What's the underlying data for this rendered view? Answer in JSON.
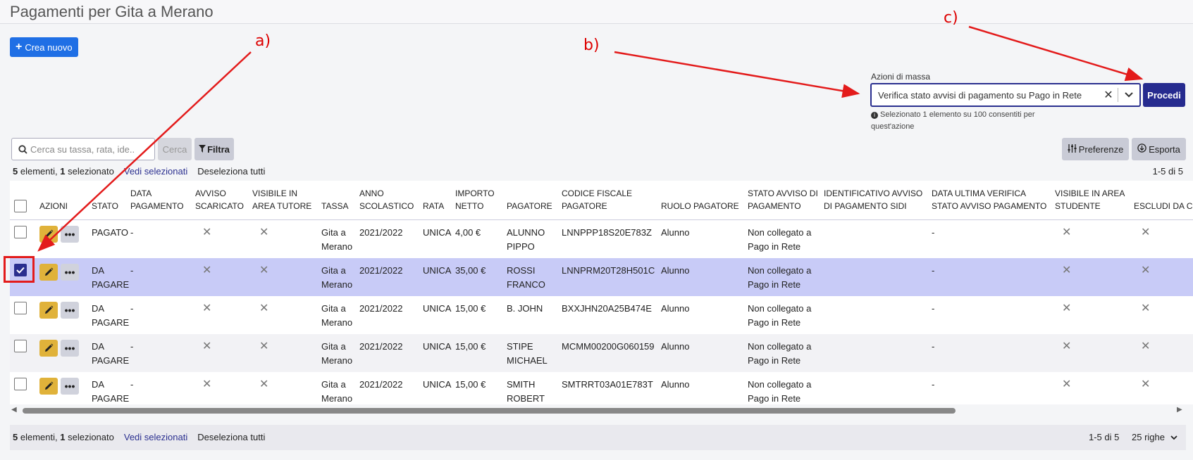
{
  "page": {
    "title": "Pagamenti per Gita a Merano"
  },
  "toolbar": {
    "create_label": "Crea nuovo",
    "search_placeholder": "Cerca su tassa, rata, ide..",
    "cerca_label": "Cerca",
    "filtra_label": "Filtra",
    "preferenze_label": "Preferenze",
    "esporta_label": "Esporta"
  },
  "mass_actions": {
    "label": "Azioni di massa",
    "selected_value": "Verifica stato avvisi di pagamento su Pago in Rete",
    "procedi_label": "Procedi",
    "hint": "Selezionato 1 elemento su 100 consentiti per quest'azione"
  },
  "summary": {
    "count": "5",
    "count_text": "elementi,",
    "selected": "1",
    "selected_text": "selezionato",
    "view_selected": "Vedi selezionati",
    "deselect_all": "Deseleziona tutti",
    "range": "1-5 di 5",
    "rows_per_page": "25 righe"
  },
  "table": {
    "headers": {
      "azioni": "AZIONI",
      "stato": "STATO",
      "data_pagamento": "DATA PAGAMENTO",
      "avviso_scaricato": "AVVISO SCARICATO",
      "visibile_tutore": "VISIBILE IN AREA TUTORE",
      "tassa": "TASSA",
      "anno": "ANNO SCOLASTICO",
      "rata": "RATA",
      "importo": "IMPORTO NETTO",
      "pagatore": "PAGATORE",
      "cf": "CODICE FISCALE PAGATORE",
      "ruolo": "RUOLO PAGATORE",
      "stato_avviso": "STATO AVVISO DI PAGAMENTO",
      "id_sidi": "IDENTIFICATIVO AVVISO DI PAGAMENTO SIDI",
      "data_verifica": "DATA ULTIMA VERIFICA STATO AVVISO PAGAMENTO",
      "visibile_studente": "VISIBILE IN AREA STUDENTE",
      "escludi": "ESCLUDI DA COMUNICAZ"
    },
    "rows": [
      {
        "selected": false,
        "stato": "PAGATO",
        "data_pagamento": "-",
        "tassa": "Gita a Merano",
        "anno": "2021/2022",
        "rata": "UNICA",
        "importo": "4,00 €",
        "pagatore": "ALUNNO PIPPO",
        "cf": "LNNPPP18S20E783Z",
        "ruolo": "Alunno",
        "stato_avviso": "Non collegato a Pago in Rete",
        "id_sidi": "",
        "data_verifica": "-"
      },
      {
        "selected": true,
        "stato": "DA PAGARE",
        "data_pagamento": "-",
        "tassa": "Gita a Merano",
        "anno": "2021/2022",
        "rata": "UNICA",
        "importo": "35,00 €",
        "pagatore": "ROSSI FRANCO",
        "cf": "LNNPRM20T28H501C",
        "ruolo": "Alunno",
        "stato_avviso": "Non collegato a Pago in Rete",
        "id_sidi": "",
        "data_verifica": "-"
      },
      {
        "selected": false,
        "stato": "DA PAGARE",
        "data_pagamento": "-",
        "tassa": "Gita a Merano",
        "anno": "2021/2022",
        "rata": "UNICA",
        "importo": "15,00 €",
        "pagatore": "B. JOHN",
        "cf": "BXXJHN20A25B474E",
        "ruolo": "Alunno",
        "stato_avviso": "Non collegato a Pago in Rete",
        "id_sidi": "",
        "data_verifica": "-"
      },
      {
        "selected": false,
        "stato": "DA PAGARE",
        "data_pagamento": "-",
        "tassa": "Gita a Merano",
        "anno": "2021/2022",
        "rata": "UNICA",
        "importo": "15,00 €",
        "pagatore": "STIPE MICHAEL",
        "cf": "MCMM00200G060159",
        "ruolo": "Alunno",
        "stato_avviso": "Non collegato a Pago in Rete",
        "id_sidi": "",
        "data_verifica": "-"
      },
      {
        "selected": false,
        "stato": "DA PAGARE",
        "data_pagamento": "-",
        "tassa": "Gita a Merano",
        "anno": "2021/2022",
        "rata": "UNICA",
        "importo": "15,00 €",
        "pagatore": "SMITH ROBERT",
        "cf": "SMTRRT03A01E783T",
        "ruolo": "Alunno",
        "stato_avviso": "Non collegato a Pago in Rete",
        "id_sidi": "",
        "data_verifica": "-"
      }
    ]
  },
  "annotations": {
    "a": "a)",
    "b": "b)",
    "c": "c)"
  },
  "colors": {
    "primary": "#262b8f",
    "create": "#1f6fe5",
    "edit": "#e0b23a",
    "selected_row": "#c8cbf7",
    "annotation": "#e31b1b"
  },
  "icons": {
    "x_mark": "✕",
    "clear": "✕",
    "info": "i"
  }
}
